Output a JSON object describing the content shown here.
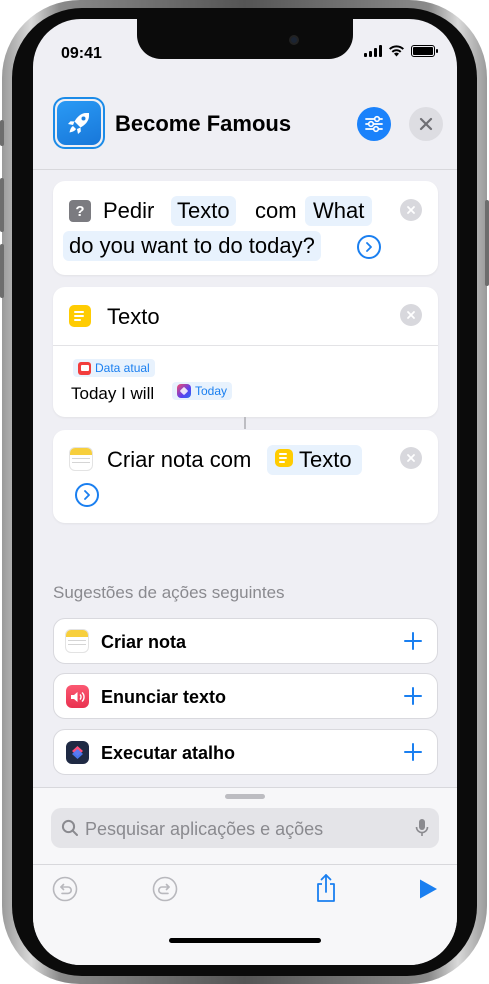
{
  "status_bar": {
    "time": "09:41"
  },
  "header": {
    "title": "Become Famous"
  },
  "action_ask": {
    "verb": "Pedir",
    "type_token": "Texto",
    "connector": "com",
    "prompt_token_line1": "What",
    "prompt_token_line2": "do you want to do today?"
  },
  "action_text": {
    "title": "Texto",
    "date_token": "Data atual",
    "body_prefix": "Today I will",
    "today_token": "Today"
  },
  "action_create_note": {
    "label": "Criar nota com",
    "input_token": "Texto"
  },
  "suggestions": {
    "section_title": "Sugestões de ações seguintes",
    "items": [
      {
        "label": "Criar nota",
        "icon": "notes-icon"
      },
      {
        "label": "Enunciar texto",
        "icon": "speech-icon"
      },
      {
        "label": "Executar atalho",
        "icon": "shortcut-icon"
      }
    ]
  },
  "search": {
    "placeholder": "Pesquisar aplicações e ações"
  },
  "colors": {
    "accent": "#1a7ff0",
    "notes_yellow": "#ffcc02",
    "background": "#efeff4"
  }
}
